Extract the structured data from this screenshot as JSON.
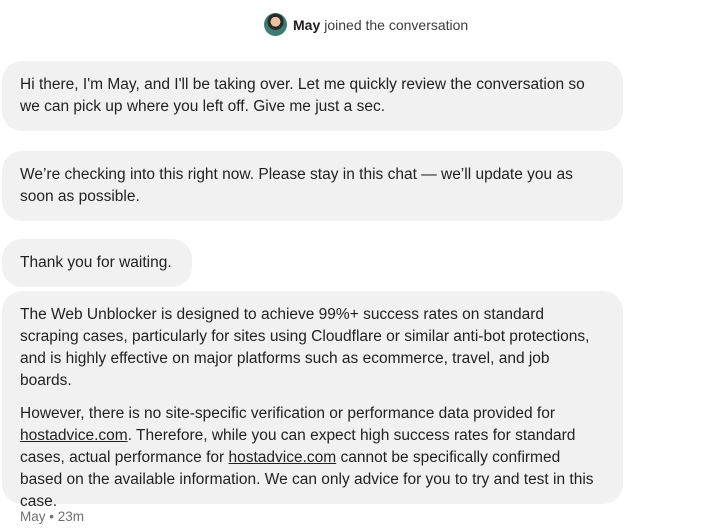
{
  "system_notice": {
    "agent_name": "May",
    "text": "joined the conversation"
  },
  "messages": {
    "m1": "Hi there, I'm May, and I'll be taking over. Let me quickly review the conversation so we can pick up where you left off. Give me just a sec.",
    "m2": "We’re checking into this right now. Please stay in this chat — we’ll update you as soon as possible.",
    "m3": "Thank you for waiting.",
    "m4": {
      "p1": "The Web Unblocker is designed to achieve 99%+ success rates on standard scraping cases, particularly for sites using Cloudflare or similar anti-bot protections, and is highly effective on major platforms such as ecommerce, travel, and job boards.",
      "p2_a": "However, there is no site-specific verification or performance data provided for ",
      "link_1": "hostadvice.com",
      "p2_b": ". Therefore, while you can expect high success rates for standard cases, actual performance for ",
      "link_2": "hostadvice.com",
      "p2_c": " cannot be specifically confirmed based on the available information. We can only advice for you to try and test in this case."
    }
  },
  "meta": {
    "text": "May • 23m"
  }
}
